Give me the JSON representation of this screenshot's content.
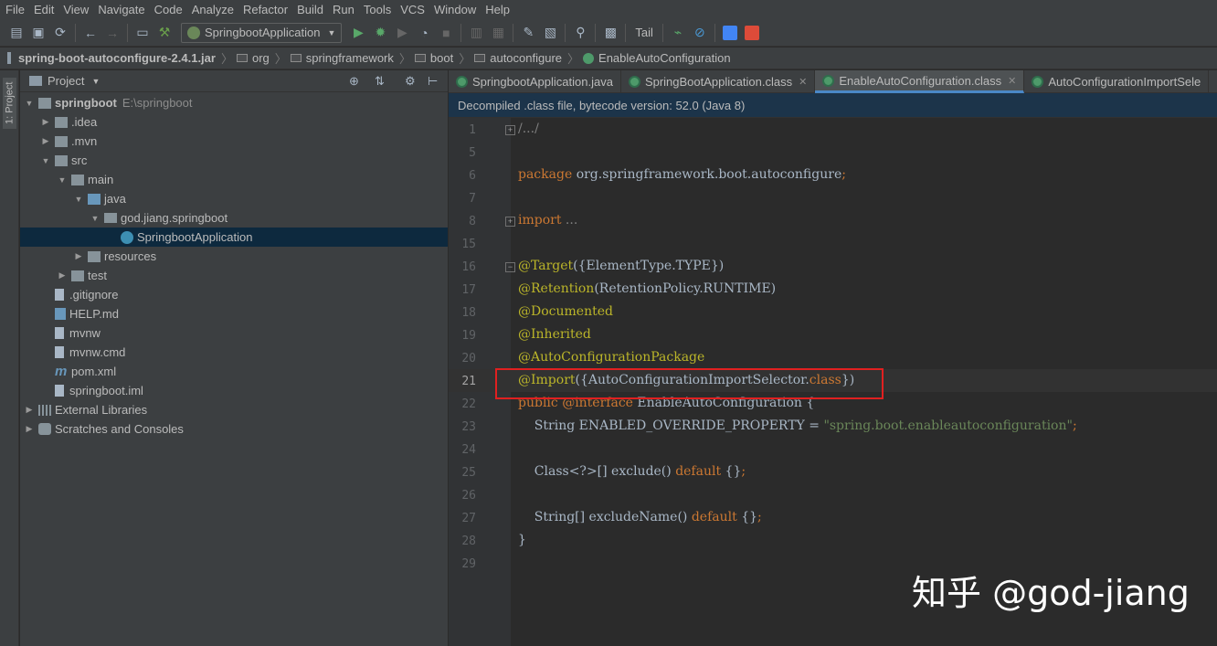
{
  "menu": [
    "File",
    "Edit",
    "View",
    "Navigate",
    "Code",
    "Analyze",
    "Refactor",
    "Build",
    "Run",
    "Tools",
    "VCS",
    "Window",
    "Help"
  ],
  "toolbar": {
    "run_config": "SpringbootApplication",
    "tail_label": "Tail"
  },
  "breadcrumbs": [
    "spring-boot-autoconfigure-2.4.1.jar",
    "org",
    "springframework",
    "boot",
    "autoconfigure",
    "EnableAutoConfiguration"
  ],
  "side_strip": {
    "label": "1: Project"
  },
  "project": {
    "header": "Project",
    "tree": [
      {
        "name": "springboot",
        "path": "E:\\springboot",
        "depth": 0,
        "icon": "folder-icon",
        "open": true
      },
      {
        "name": ".idea",
        "depth": 1,
        "icon": "folder-icon",
        "open": false
      },
      {
        "name": ".mvn",
        "depth": 1,
        "icon": "folder-icon",
        "open": false
      },
      {
        "name": "src",
        "depth": 1,
        "icon": "folder-icon",
        "open": true
      },
      {
        "name": "main",
        "depth": 2,
        "icon": "folder-icon",
        "open": true
      },
      {
        "name": "java",
        "depth": 3,
        "icon": "source-folder-icon",
        "open": true
      },
      {
        "name": "god.jiang.springboot",
        "depth": 4,
        "icon": "package-icon",
        "open": true
      },
      {
        "name": "SpringbootApplication",
        "depth": 5,
        "icon": "class-icon",
        "selected": true
      },
      {
        "name": "resources",
        "depth": 3,
        "icon": "resources-folder-icon",
        "open": false
      },
      {
        "name": "test",
        "depth": 2,
        "icon": "folder-icon",
        "open": false
      },
      {
        "name": ".gitignore",
        "depth": 1,
        "icon": "file-icon"
      },
      {
        "name": "HELP.md",
        "depth": 1,
        "icon": "markdown-icon"
      },
      {
        "name": "mvnw",
        "depth": 1,
        "icon": "file-icon"
      },
      {
        "name": "mvnw.cmd",
        "depth": 1,
        "icon": "file-icon"
      },
      {
        "name": "pom.xml",
        "depth": 1,
        "icon": "maven-icon"
      },
      {
        "name": "springboot.iml",
        "depth": 1,
        "icon": "file-icon"
      },
      {
        "name": "External Libraries",
        "depth": 0,
        "icon": "libraries-icon",
        "open": false
      },
      {
        "name": "Scratches and Consoles",
        "depth": 0,
        "icon": "scratches-icon",
        "open": false
      }
    ]
  },
  "tabs": [
    {
      "label": "SpringbootApplication.java",
      "active": false,
      "closable": false
    },
    {
      "label": "SpringBootApplication.class",
      "active": false,
      "closable": true
    },
    {
      "label": "EnableAutoConfiguration.class",
      "active": true,
      "closable": true
    },
    {
      "label": "AutoConfigurationImportSele",
      "active": false,
      "closable": false
    }
  ],
  "banner": "Decompiled .class file, bytecode version: 52.0 (Java 8)",
  "code": {
    "current_line": "21",
    "lines": [
      {
        "n": "1",
        "fold": "+",
        "segs": [
          {
            "t": "/.../",
            "c": "gr"
          }
        ]
      },
      {
        "n": "5",
        "segs": []
      },
      {
        "n": "6",
        "segs": [
          {
            "t": "package ",
            "c": "kw"
          },
          {
            "t": "org.springframework.boot.autoconfigure",
            "c": ""
          },
          {
            "t": ";",
            "c": "kw"
          }
        ]
      },
      {
        "n": "7",
        "segs": []
      },
      {
        "n": "8",
        "fold": "+",
        "segs": [
          {
            "t": "import ",
            "c": "kw"
          },
          {
            "t": "...",
            "c": "gr"
          }
        ]
      },
      {
        "n": "15",
        "segs": []
      },
      {
        "n": "16",
        "fold": "-",
        "segs": [
          {
            "t": "@Target",
            "c": "an"
          },
          {
            "t": "({ElementType.TYPE})",
            "c": ""
          }
        ]
      },
      {
        "n": "17",
        "segs": [
          {
            "t": "@Retention",
            "c": "an"
          },
          {
            "t": "(RetentionPolicy.RUNTIME)",
            "c": ""
          }
        ]
      },
      {
        "n": "18",
        "segs": [
          {
            "t": "@Documented",
            "c": "an"
          }
        ]
      },
      {
        "n": "19",
        "segs": [
          {
            "t": "@Inherited",
            "c": "an"
          }
        ]
      },
      {
        "n": "20",
        "segs": [
          {
            "t": "@AutoConfigurationPackage",
            "c": "an"
          }
        ]
      },
      {
        "n": "21",
        "segs": [
          {
            "t": "@Import",
            "c": "an"
          },
          {
            "t": "({AutoConfigurationImportSelector.",
            "c": ""
          },
          {
            "t": "class",
            "c": "kw"
          },
          {
            "t": "})",
            "c": ""
          }
        ]
      },
      {
        "n": "22",
        "segs": [
          {
            "t": "public ",
            "c": "kw"
          },
          {
            "t": "@interface ",
            "c": "kw"
          },
          {
            "t": "EnableAutoConfiguration {",
            "c": ""
          }
        ]
      },
      {
        "n": "23",
        "segs": [
          {
            "t": "    String ENABLED_OVERRIDE_PROPERTY = ",
            "c": ""
          },
          {
            "t": "\"spring.boot.enableautoconfiguration\"",
            "c": "st"
          },
          {
            "t": ";",
            "c": "kw"
          }
        ]
      },
      {
        "n": "24",
        "segs": []
      },
      {
        "n": "25",
        "segs": [
          {
            "t": "    Class<?>[] exclude() ",
            "c": ""
          },
          {
            "t": "default ",
            "c": "kw"
          },
          {
            "t": "{}",
            "c": ""
          },
          {
            "t": ";",
            "c": "kw"
          }
        ]
      },
      {
        "n": "26",
        "segs": []
      },
      {
        "n": "27",
        "segs": [
          {
            "t": "    String[] excludeName() ",
            "c": ""
          },
          {
            "t": "default ",
            "c": "kw"
          },
          {
            "t": "{}",
            "c": ""
          },
          {
            "t": ";",
            "c": "kw"
          }
        ]
      },
      {
        "n": "28",
        "segs": [
          {
            "t": "}",
            "c": ""
          }
        ]
      },
      {
        "n": "29",
        "segs": []
      }
    ]
  },
  "colors": {
    "highlight_box": "#e02020",
    "keyword": "#cc7832",
    "annotation": "#bbb529",
    "string": "#6a8759",
    "selection": "#0d293e",
    "active_tab_underline": "#4a88c7"
  },
  "watermark": "知乎 @god-jiang"
}
